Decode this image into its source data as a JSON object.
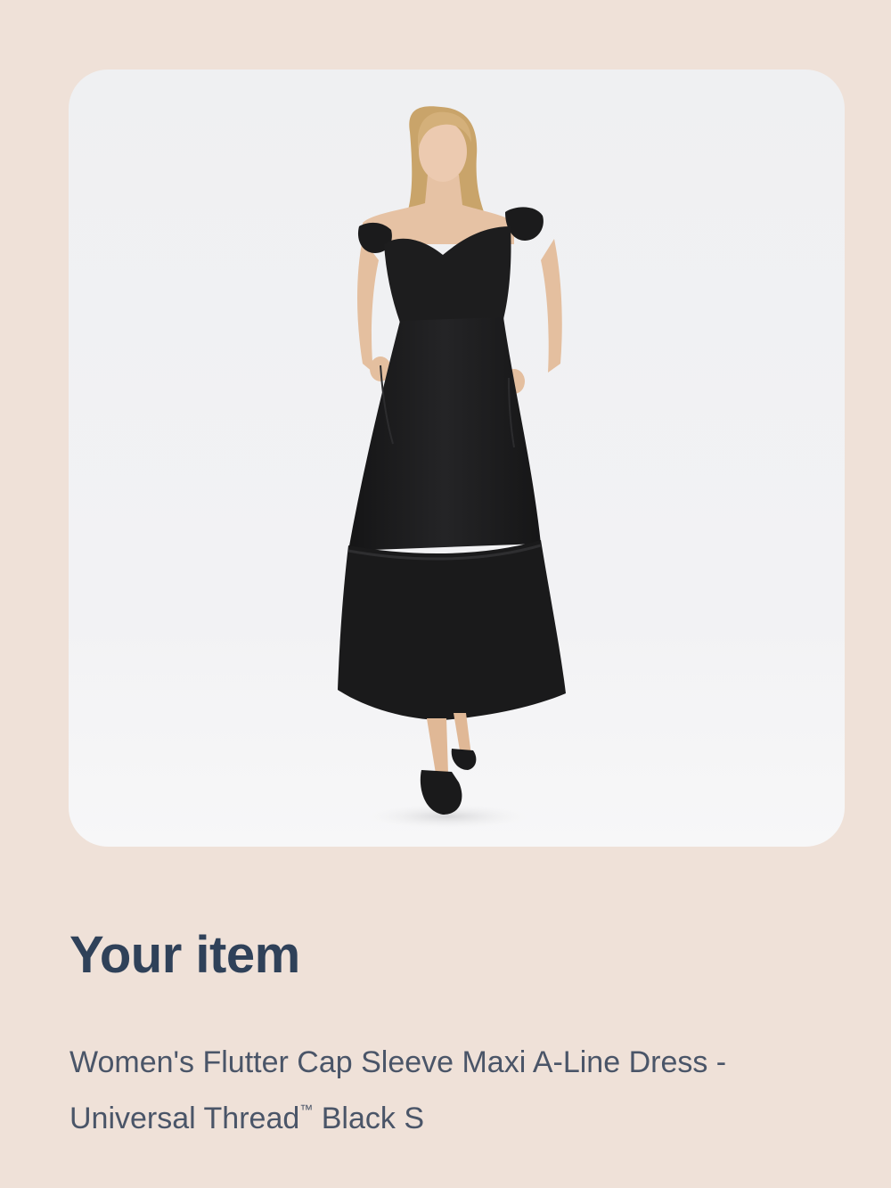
{
  "card": {
    "image_alt": "Woman wearing a black flutter cap sleeve tiered maxi dress with black sandals"
  },
  "heading": "Your item",
  "product": {
    "name_part1": "Women's Flutter Cap Sleeve Maxi A-Line Dress - Universal Thread",
    "trademark": "™",
    "name_part2": " Black S"
  },
  "colors": {
    "background": "#efe1d8",
    "heading": "#2f4159",
    "body_text": "#4a5568",
    "dress": "#1c1c1d"
  }
}
